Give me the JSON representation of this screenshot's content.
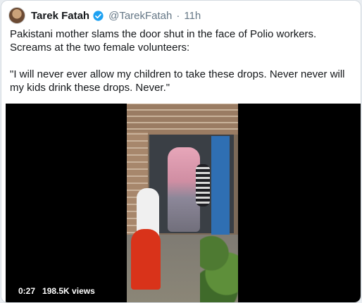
{
  "tweet": {
    "author_name": "Tarek Fatah",
    "handle": "@TarekFatah",
    "separator": "·",
    "time": "11h",
    "text": "Pakistani mother slams the door shut in the face of Polio workers.\nScreams at the two female volunteers:\n\n\"I will never ever allow my children to take these drops. Never never will\nmy kids drink these drops. Never.\"",
    "icons": [
      "avatar",
      "verified-badge-icon"
    ],
    "colors": {
      "verified": "#1da1f2",
      "handle": "#657786"
    }
  },
  "video": {
    "duration": "0:27",
    "views": "198.5K views"
  }
}
